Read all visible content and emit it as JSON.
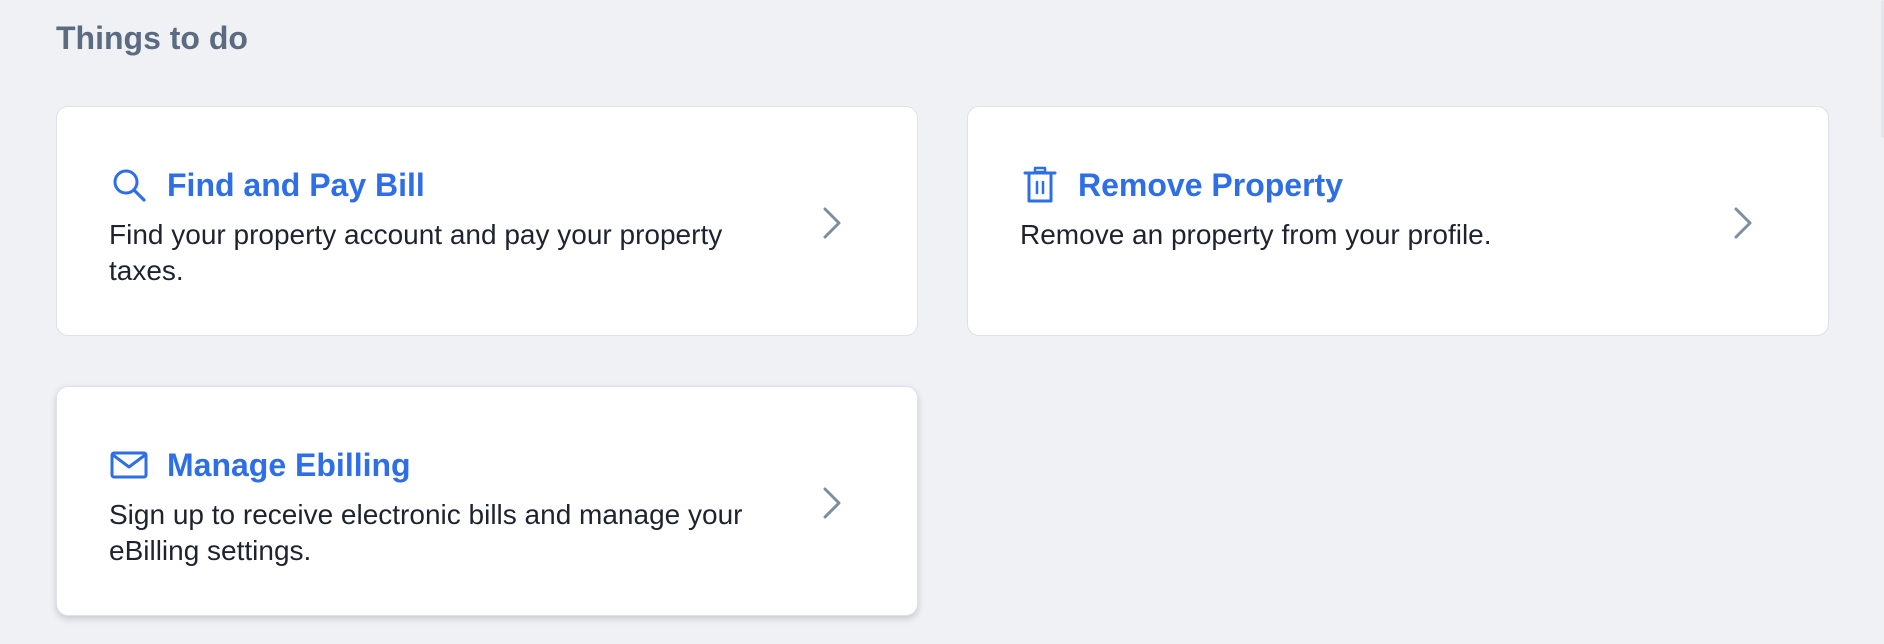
{
  "section": {
    "title": "Things to do"
  },
  "cards": [
    {
      "title": "Find and Pay Bill",
      "description": "Find your property account and pay your property taxes.",
      "icon": "search-icon"
    },
    {
      "title": "Remove Property",
      "description": "Remove an property from your profile.",
      "icon": "trash-icon"
    },
    {
      "title": "Manage Ebilling",
      "description": "Sign up to receive electronic bills and manage your eBilling settings.",
      "icon": "envelope-icon"
    }
  ],
  "colors": {
    "background": "#f0f1f5",
    "accent": "#2e6ee6",
    "heading": "#5b6b80",
    "body_text": "#1e2330",
    "chevron": "#7d8ea3"
  }
}
